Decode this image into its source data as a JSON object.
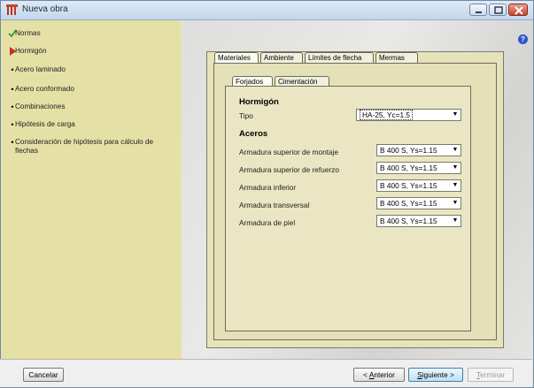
{
  "window": {
    "title": "Nueva obra"
  },
  "sidebar": {
    "items": [
      {
        "label": "Normas",
        "marker": "check"
      },
      {
        "label": "Hormigón",
        "marker": "arrow"
      },
      {
        "label": "Acero laminado",
        "marker": "dot"
      },
      {
        "label": "Acero conformado",
        "marker": "dot"
      },
      {
        "label": "Combinaciones",
        "marker": "dot"
      },
      {
        "label": "Hipótesis de carga",
        "marker": "dot"
      },
      {
        "label": "Consideración de hipótesis para cálculo de flechas",
        "marker": "dot"
      }
    ]
  },
  "tabs": {
    "outer": [
      "Materiales",
      "Ambiente",
      "Límites de flecha",
      "Mermas"
    ],
    "inner": [
      "Forjados",
      "Cimentación"
    ]
  },
  "form": {
    "hormigon": {
      "title": "Hormigón",
      "tipo_label": "Tipo",
      "tipo_value": "HA-25, Yc=1.5"
    },
    "aceros": {
      "title": "Aceros",
      "rows": [
        {
          "label": "Armadura superior de montaje",
          "value": "B 400 S, Ys=1.15"
        },
        {
          "label": "Armadura superior de refuerzo",
          "value": "B 400 S, Ys=1.15"
        },
        {
          "label": "Armadura inferior",
          "value": "B 400 S, Ys=1.15"
        },
        {
          "label": "Armadura transversal",
          "value": "B 400 S, Ys=1.15"
        },
        {
          "label": "Armadura de piel",
          "value": "B 400 S, Ys=1.15"
        }
      ]
    }
  },
  "footer": {
    "cancel": "Cancelar",
    "back_prefix": "< ",
    "back_mnemonic": "A",
    "back_rest": "nterior",
    "next_mnemonic": "S",
    "next_rest": "iguiente >",
    "finish_mnemonic": "T",
    "finish_rest": "erminar"
  },
  "colors": {
    "sidebar_bg": "#e5e1a6",
    "panel_bg": "#e6e2ba",
    "check": "#2f9a2a",
    "arrow": "#c3321d",
    "close_button": "#c9412b"
  }
}
